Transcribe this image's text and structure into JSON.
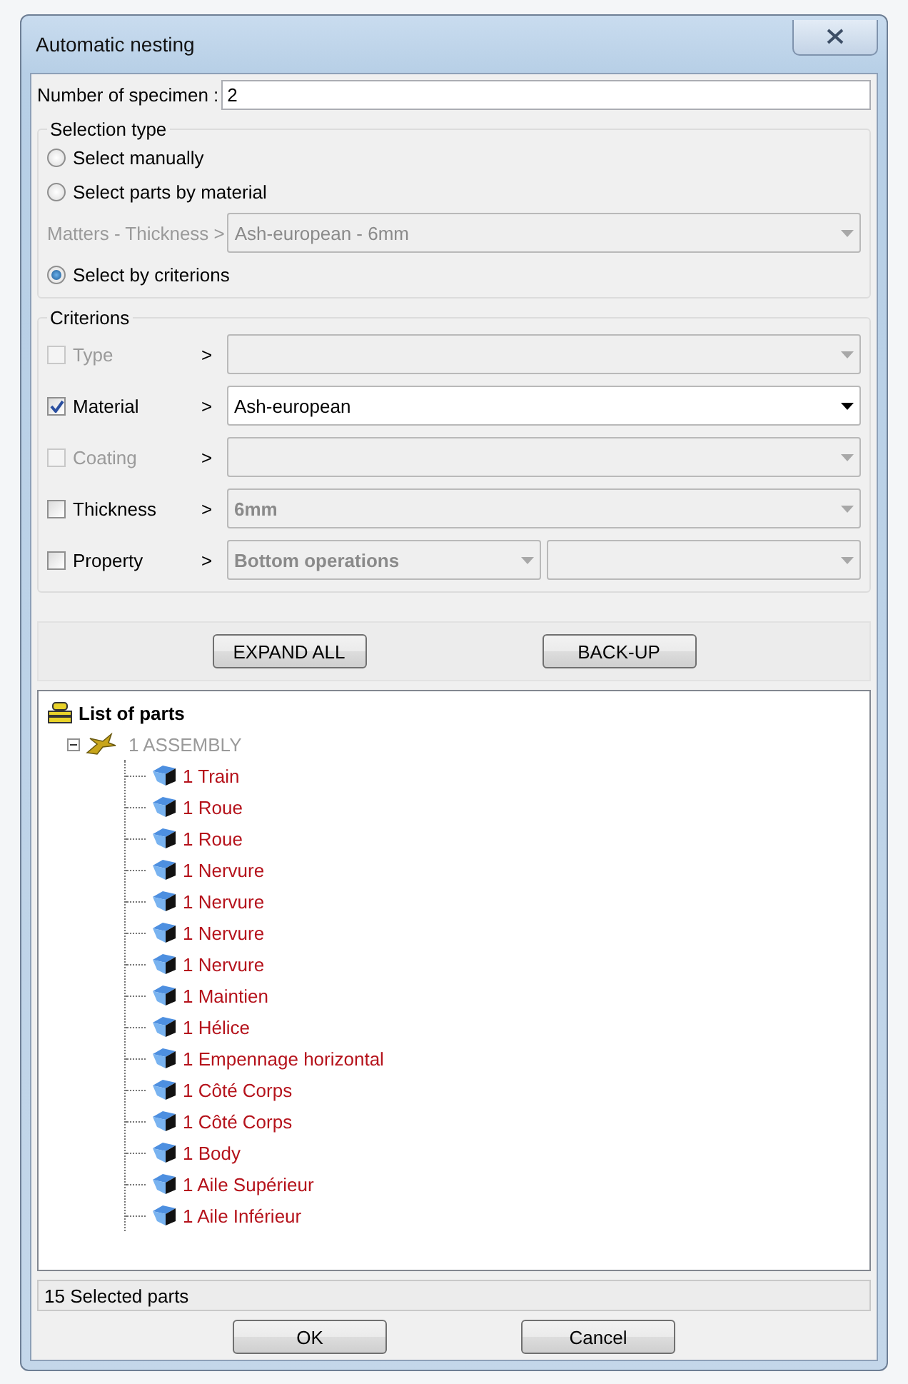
{
  "window": {
    "title": "Automatic nesting"
  },
  "specimen": {
    "label": "Number of specimen :",
    "value": "2"
  },
  "selection_type": {
    "title": "Selection type",
    "options": [
      {
        "label": "Select manually",
        "selected": false
      },
      {
        "label": "Select parts by material",
        "selected": false
      },
      {
        "label": "Select by criterions",
        "selected": true
      }
    ],
    "matter": {
      "label": "Matters - Thickness >",
      "value": "Ash-european - 6mm",
      "disabled": true
    }
  },
  "criterions": {
    "title": "Criterions",
    "rows": [
      {
        "label": "Type",
        "arrow": ">",
        "checked": false,
        "disabled": true,
        "combos": [
          {
            "enabled": false
          }
        ]
      },
      {
        "label": "Material",
        "arrow": ">",
        "checked": true,
        "disabled": false,
        "combos": [
          {
            "value": "Ash-european",
            "enabled": true
          }
        ]
      },
      {
        "label": "Coating",
        "arrow": ">",
        "checked": false,
        "disabled": true,
        "combos": [
          {
            "enabled": false
          }
        ]
      },
      {
        "label": "Thickness",
        "arrow": ">",
        "checked": false,
        "disabled": false,
        "combos": [
          {
            "value": "6mm",
            "enabled": false
          }
        ]
      },
      {
        "label": "Property",
        "arrow": ">",
        "checked": false,
        "disabled": false,
        "combos": [
          {
            "value": "Bottom operations",
            "enabled": false
          },
          {
            "enabled": false
          }
        ]
      }
    ]
  },
  "actions": [
    "EXPAND ALL",
    "BACK-UP"
  ],
  "tree": {
    "label": "List of parts",
    "kind": "root",
    "children": [
      {
        "label": "1 ASSEMBLY",
        "kind": "assembly",
        "expanded": true,
        "children": [
          {
            "label": "1 Train",
            "kind": "part"
          },
          {
            "label": "1 Roue",
            "kind": "part"
          },
          {
            "label": "1 Roue",
            "kind": "part"
          },
          {
            "label": "1 Nervure",
            "kind": "part"
          },
          {
            "label": "1 Nervure",
            "kind": "part"
          },
          {
            "label": "1 Nervure",
            "kind": "part"
          },
          {
            "label": "1 Nervure",
            "kind": "part"
          },
          {
            "label": "1 Maintien",
            "kind": "part"
          },
          {
            "label": "1 Hélice",
            "kind": "part"
          },
          {
            "label": "1 Empennage horizontal",
            "kind": "part"
          },
          {
            "label": "1 Côté Corps",
            "kind": "part"
          },
          {
            "label": "1 Côté Corps",
            "kind": "part"
          },
          {
            "label": "1 Body",
            "kind": "part"
          },
          {
            "label": "1 Aile Supérieur",
            "kind": "part"
          },
          {
            "label": "1 Aile Inférieur",
            "kind": "part"
          }
        ]
      }
    ]
  },
  "status_bar": "15 Selected parts",
  "buttons": [
    "OK",
    "Cancel"
  ]
}
